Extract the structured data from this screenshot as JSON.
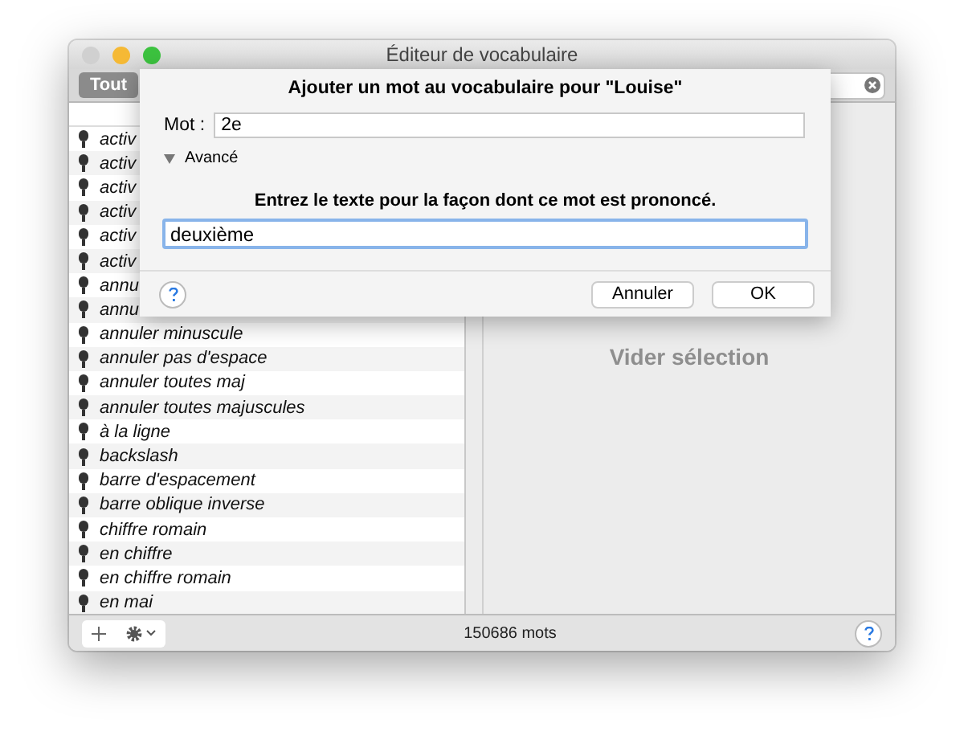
{
  "window": {
    "title": "Éditeur de vocabulaire"
  },
  "toolbar": {
    "filter_button": "Tout"
  },
  "words": [
    {
      "text": "activ"
    },
    {
      "text": "activ"
    },
    {
      "text": "activ"
    },
    {
      "text": "activ"
    },
    {
      "text": "activ"
    },
    {
      "text": "activ"
    },
    {
      "text": "annu"
    },
    {
      "text": "annu"
    },
    {
      "text": "annuler minuscule"
    },
    {
      "text": "annuler pas d'espace"
    },
    {
      "text": "annuler toutes maj"
    },
    {
      "text": "annuler toutes majuscules"
    },
    {
      "text": "à la ligne"
    },
    {
      "text": "backslash"
    },
    {
      "text": "barre d'espacement"
    },
    {
      "text": "barre oblique inverse"
    },
    {
      "text": "chiffre romain"
    },
    {
      "text": "en chiffre"
    },
    {
      "text": "en chiffre romain"
    },
    {
      "text": "en mai"
    }
  ],
  "detail": {
    "empty_label": "Vider sélection"
  },
  "status": {
    "count": "150686 mots"
  },
  "dialog": {
    "title": "Ajouter un mot au vocabulaire pour \"Louise\"",
    "word_label": "Mot :",
    "word_value": "2e",
    "advanced": {
      "label": "Avancé",
      "expanded": true
    },
    "prompt": "Entrez le texte pour la façon dont ce mot est prononcé.",
    "pronunciation": "deuxième",
    "buttons": [
      "Annuler",
      "OK"
    ]
  }
}
